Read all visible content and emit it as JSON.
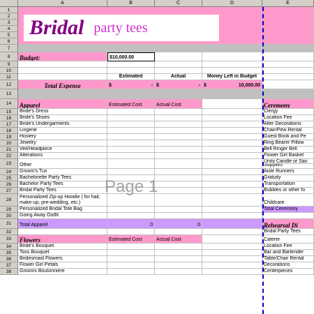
{
  "columns": [
    "A",
    "B",
    "C",
    "D",
    "E"
  ],
  "rows": [
    "1",
    "2",
    "3",
    "4",
    "5",
    "6",
    "7",
    "8",
    "9",
    "10",
    "11",
    "12",
    "13",
    "14",
    "15",
    "16",
    "17",
    "18",
    "19",
    "20",
    "21",
    "22",
    "23",
    "24",
    "25",
    "26",
    "27",
    "28",
    "29",
    "30",
    "31",
    "32",
    "33",
    "34",
    "35",
    "36",
    "37",
    "38"
  ],
  "banner": {
    "title": "Bridal",
    "subtitle": "party tees"
  },
  "budget": {
    "label": "Budget:",
    "value": "$10,000.00"
  },
  "summary": {
    "estimated_hdr": "Estimated",
    "actual_hdr": "Actual",
    "left_hdr": "Money Left in Budget",
    "total_label": "Total Expense",
    "est_currency": "$",
    "est_value": "-",
    "act_currency": "$",
    "act_value": "-",
    "left_currency": "$",
    "left_value": "10,000.00"
  },
  "apparel": {
    "header": "Apparel",
    "est_hdr": "Estimated Cost",
    "act_hdr": "Actual Cost",
    "items": [
      "Bride's Dress",
      "Bride's Shoes",
      "Bride's Undergarments",
      "Lingerie",
      "Hosiery",
      "Jewelry",
      "Veil/Headpiece",
      "Alterations",
      "Other",
      "Groom's Tux",
      "Bachelorette Party Tees",
      "Bachelor Party Tees",
      "Bridal Party Tees",
      "Personalized Zip-up Hoodie ( for hair, make-up, pre-wedding, etc.)",
      "Personalized Bridal Tote Bag",
      "Going Away Outfit"
    ],
    "total_label": "Total Apparel",
    "total_est": "0",
    "total_act": "0"
  },
  "flowers": {
    "header": "Flowers",
    "est_hdr": "Estimated Cost",
    "act_hdr": "Actual Cost",
    "items": [
      "Bride's Bouquet",
      "Toss Bouquet",
      "Bridesmaid Flowers",
      "Flower Girl Petals",
      "Grooms Boutonniere"
    ]
  },
  "ceremony": {
    "header": "Ceremony",
    "items": [
      "Clergy",
      "Location Fee",
      "Alter Decorations",
      "Chair/Pew Rental",
      "Guest Book and Pe",
      "Ring Bearer Pillow",
      "Bell Ringer Bell",
      "Flower Girl Basket",
      "Unity Candle or San",
      "Supplies",
      "Aisle Runners",
      "Gratuity",
      "Transportation",
      "Bubbles or other fo",
      "Childcare"
    ],
    "total_label": "Total Ceremony"
  },
  "rehearsal": {
    "header": "Rehearsal Di",
    "items": [
      "Bridal Party Tees",
      "Caterer",
      "Location Fee",
      "Bar and Bartender",
      "Table/Chair Rental",
      "Decorations",
      "Centerpieces"
    ]
  },
  "watermark": "Page 1"
}
